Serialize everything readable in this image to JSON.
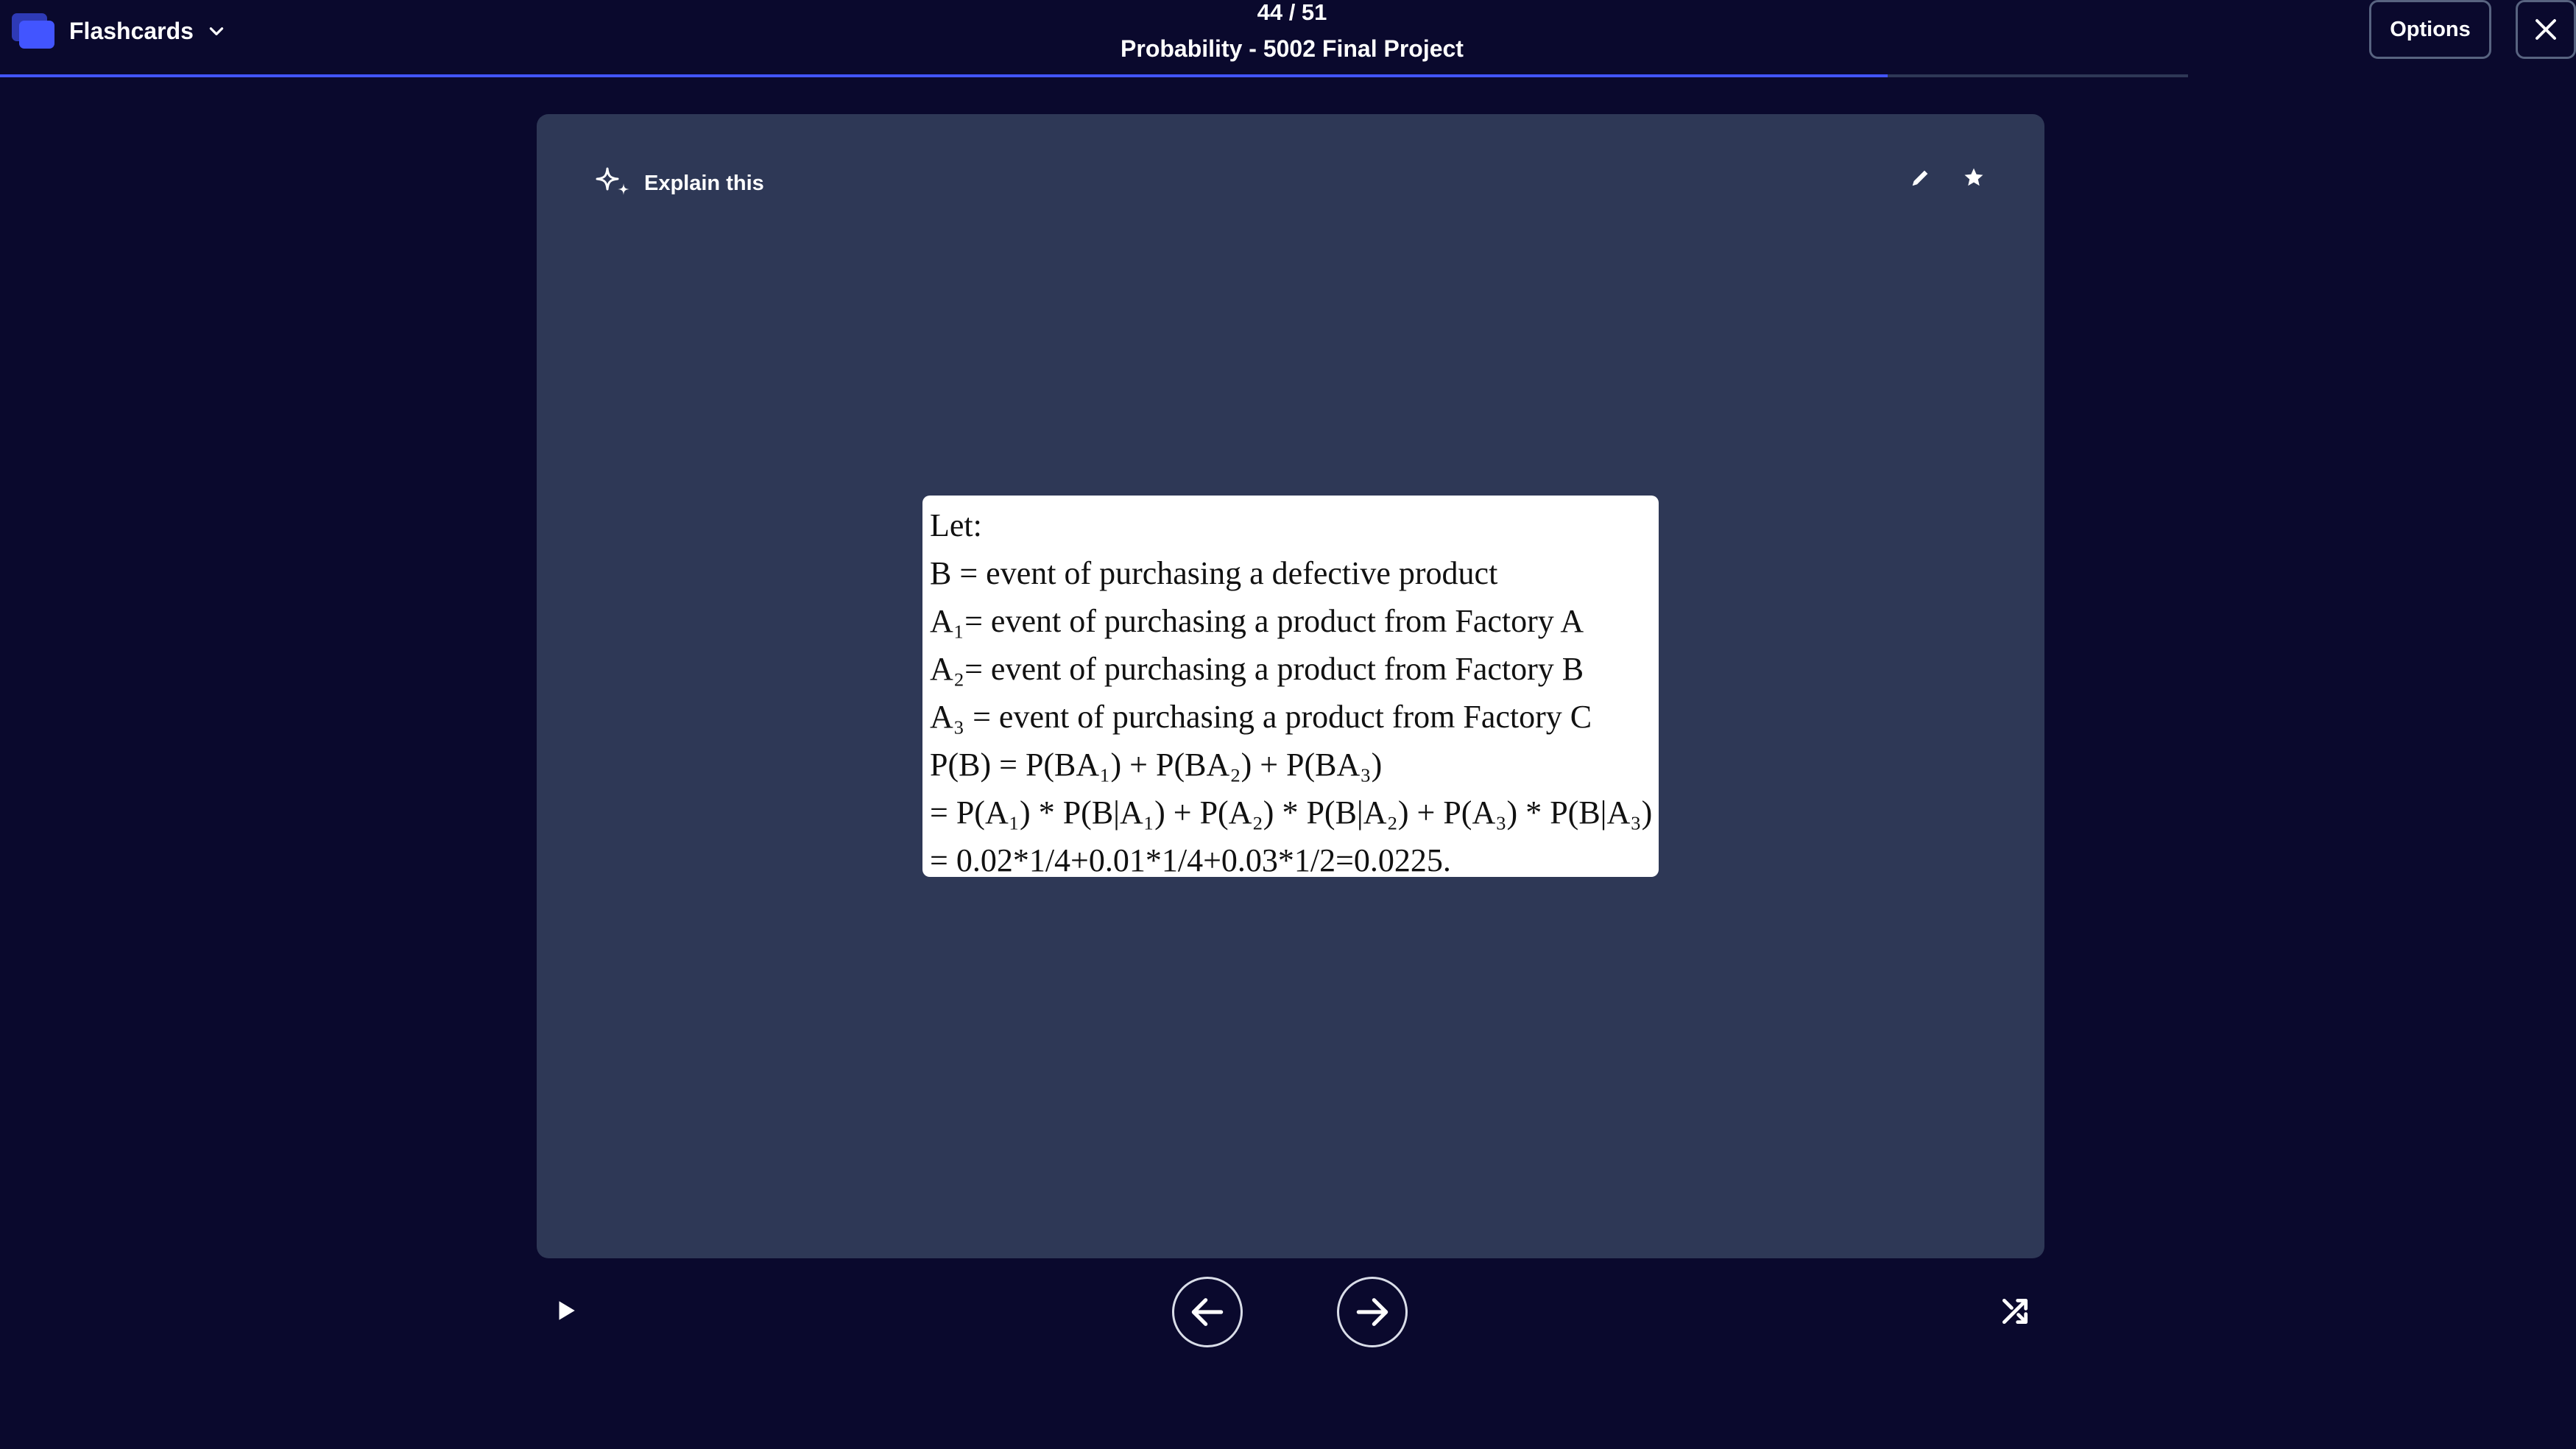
{
  "header": {
    "mode_label": "Flashcards",
    "progress_count": "44 / 51",
    "progress_fraction": 0.8627,
    "set_title": "Probability - 5002 Final Project",
    "options_label": "Options"
  },
  "card": {
    "explain_label": "Explain this",
    "content_lines": [
      "Let:",
      "B = event of purchasing a defective product",
      "A₁= event of purchasing a product from Factory A",
      "A₂= event of purchasing a product from Factory B",
      "A₃ = event of purchasing a product from Factory C",
      "P(B) = P(BA₁) + P(BA₂) + P(BA₃)",
      "= P(A₁) * P(B|A₁) + P(A₂) * P(B|A₂) + P(A₃) * P(B|A₃)",
      "= 0.02*1/4+0.01*1/4+0.03*1/2=0.0225."
    ]
  },
  "icons": {
    "mode": "flashcards-icon",
    "chevron": "chevron-down-icon",
    "close": "close-icon",
    "explain": "sparkle-icon",
    "edit": "pencil-icon",
    "star": "star-icon",
    "play": "play-icon",
    "prev": "arrow-left-icon",
    "next": "arrow-right-icon",
    "shuffle": "shuffle-icon"
  },
  "colors": {
    "background": "#0a092d",
    "card": "#2e3856",
    "accent": "#4255ff"
  }
}
